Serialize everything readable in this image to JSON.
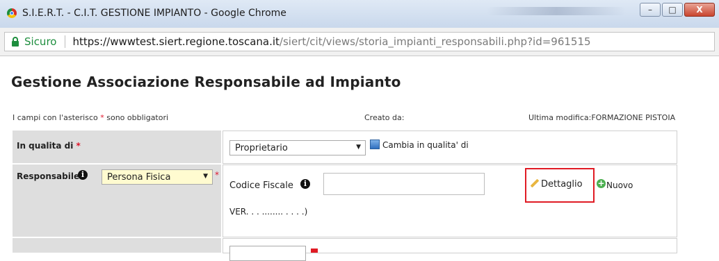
{
  "window": {
    "title": "S.I.E.R.T. - C.I.T. GESTIONE IMPIANTO - Google Chrome",
    "minimize_glyph": "–",
    "maximize_glyph": "□",
    "close_glyph": "X"
  },
  "address_bar": {
    "secure_label": "Sicuro",
    "url_host": "https://wwwtest.siert.regione.toscana.it",
    "url_path": "/siert/cit/views/storia_impianti_responsabili.php?id=961515"
  },
  "page": {
    "title": "Gestione Associazione Responsabile ad Impianto",
    "required_note_before": "I campi con l'asterisco ",
    "required_star": "*",
    "required_note_after": " sono obbligatori",
    "created_by_label": "Creato da:",
    "last_modified_label": "Ultima modifica:FORMAZIONE PISTOIA"
  },
  "form": {
    "in_qualita": {
      "label": "In qualita di ",
      "star": "*",
      "selected": "Proprietario",
      "change_label": "Cambia in qualita' di"
    },
    "responsabile": {
      "label": "Responsabile",
      "info_glyph": "i",
      "type_selected": "Persona Fisica",
      "star": "*",
      "codice_fiscale_label": "Codice Fiscale",
      "codice_fiscale_value": "",
      "dettaglio_label": "Dettaglio",
      "nuovo_label": "Nuovo",
      "name_partial": "VER.  . . ........ . . . .)"
    }
  },
  "icons": {
    "lock": "lock-icon",
    "info": "info-icon",
    "change": "blue-square-icon",
    "edit": "pencil-icon",
    "add": "plus-circle-icon"
  }
}
